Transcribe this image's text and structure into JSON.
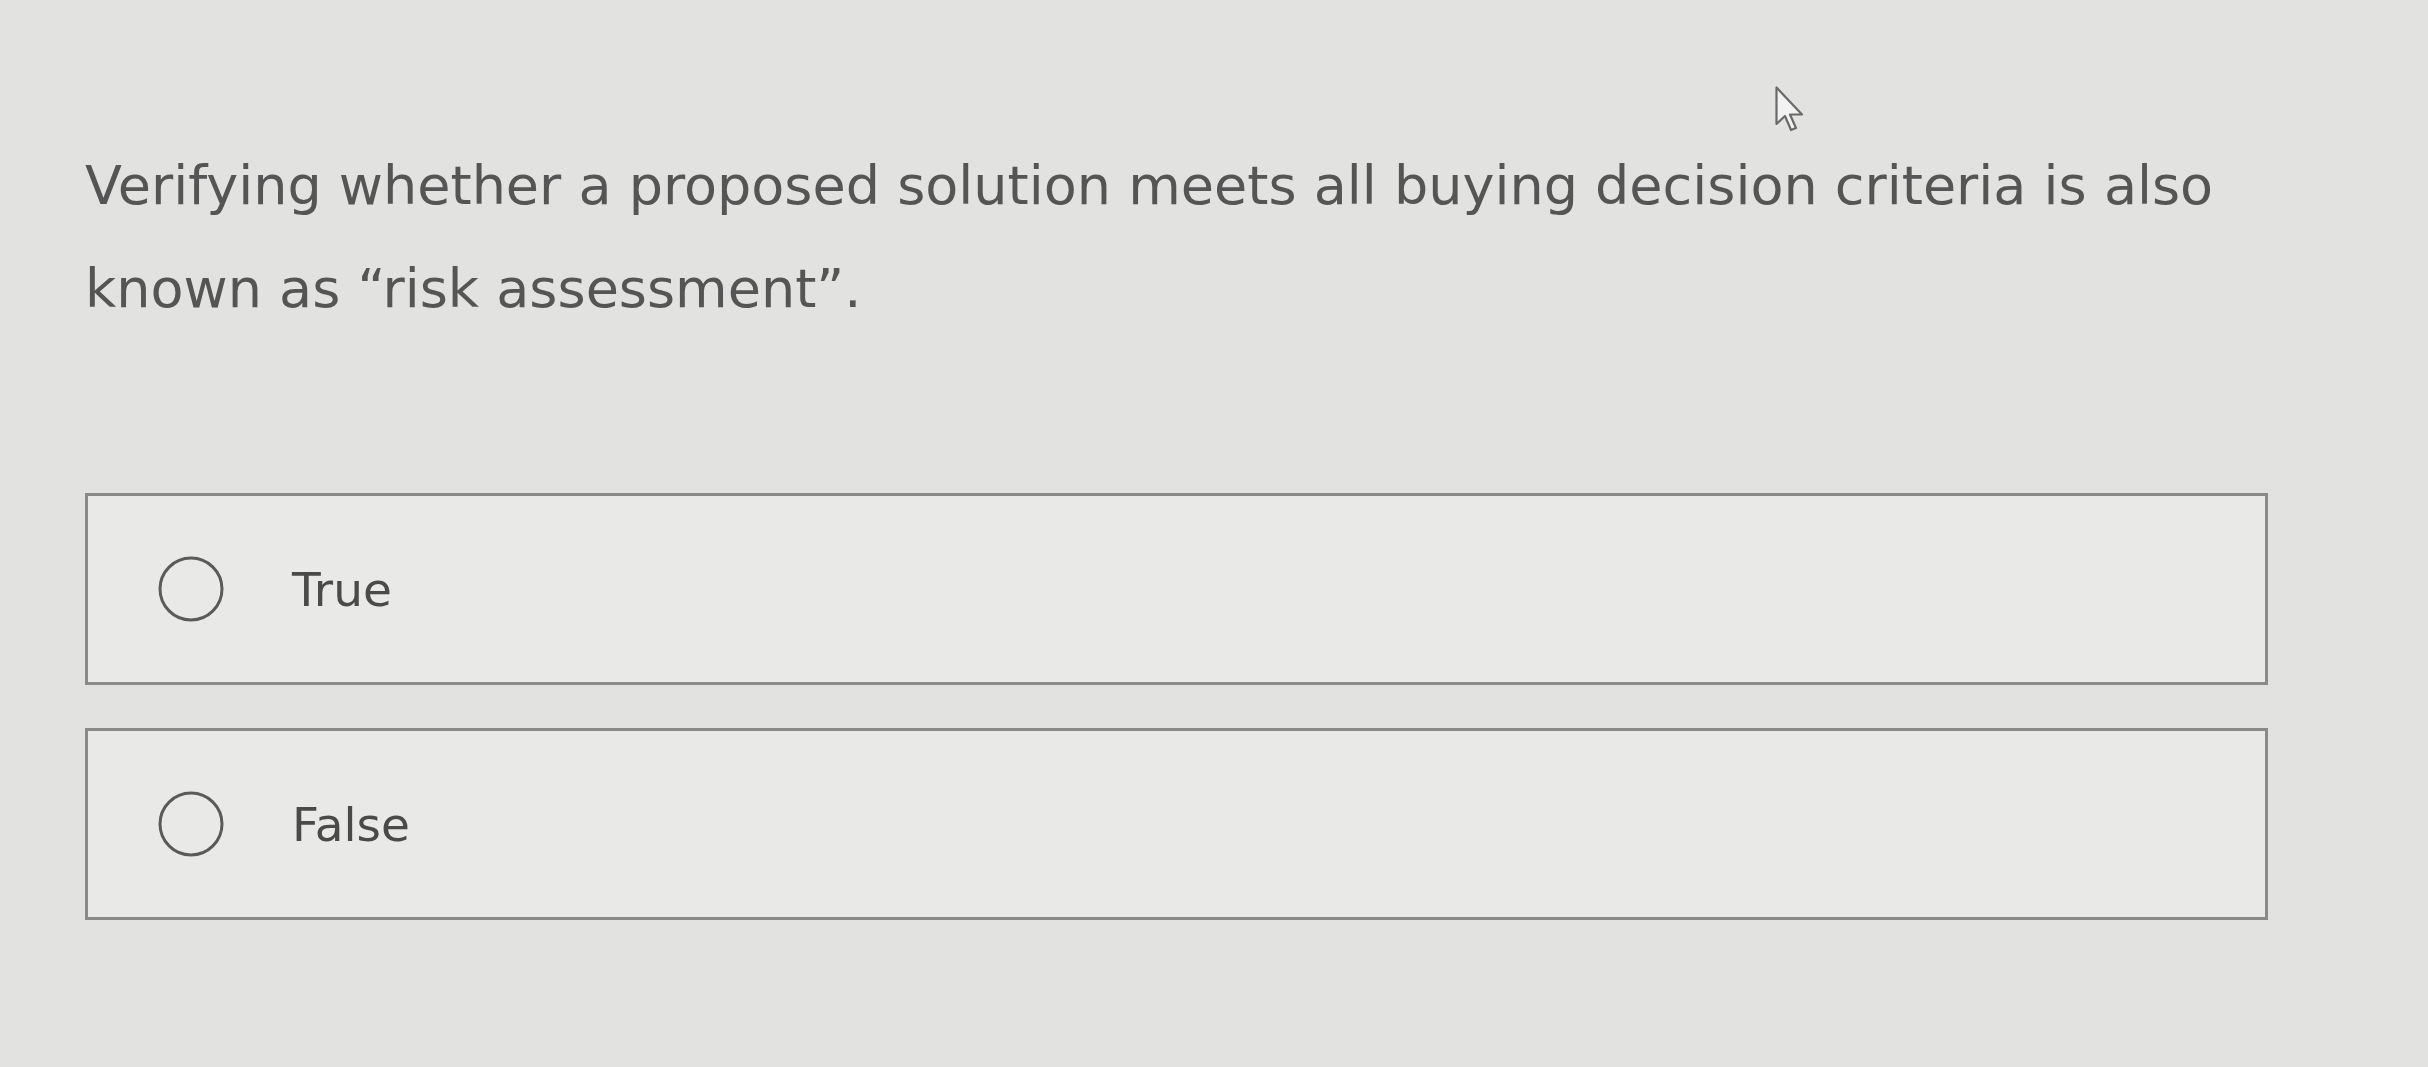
{
  "question": {
    "text": "Verifying whether a proposed solution meets all buying decision criteria is also known as “risk assessment”."
  },
  "options": [
    {
      "label": "True",
      "selected": false
    },
    {
      "label": "False",
      "selected": false
    }
  ]
}
